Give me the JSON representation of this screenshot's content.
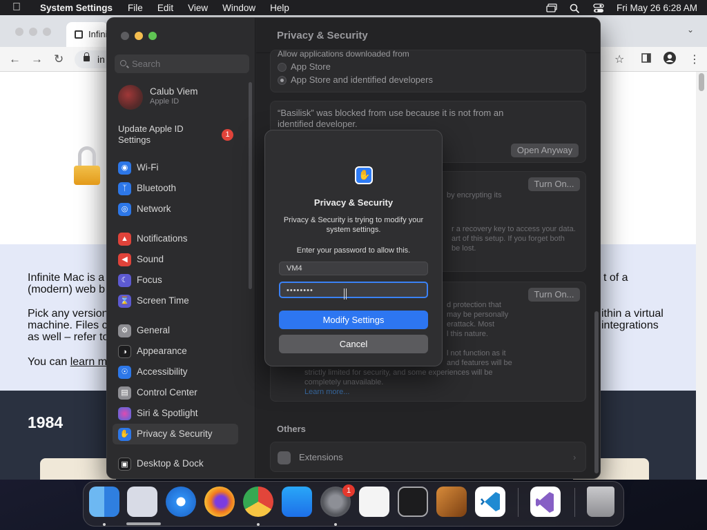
{
  "menubar": {
    "app": "System Settings",
    "items": [
      "File",
      "Edit",
      "View",
      "Window",
      "Help"
    ],
    "clock": "Fri May 26  6:28 AM"
  },
  "browser": {
    "tab_title": "Infini",
    "url": "in",
    "page_text": {
      "p1_line1": "Infinite Mac is a",
      "p1_line2": "(modern) web b",
      "p1_right": "t of a",
      "p2_line1": "Pick any version",
      "p2_line2": "machine. Files c",
      "p2_line3": "as well – refer to",
      "p2_right1": "ithin a virtual",
      "p2_right2": "integrations",
      "p3_prefix": "You can ",
      "p3_link": "learn m",
      "year": "1984"
    }
  },
  "settings": {
    "search_placeholder": "Search",
    "user": {
      "name": "Calub Viem",
      "subtitle": "Apple ID"
    },
    "update": {
      "line1": "Update Apple ID",
      "line2": "Settings",
      "badge": "1"
    },
    "sidebar": [
      {
        "label": "Wi-Fi",
        "icon": "wifi-icon",
        "color": "#2d77e8"
      },
      {
        "label": "Bluetooth",
        "icon": "bluetooth-icon",
        "color": "#2d77e8"
      },
      {
        "label": "Network",
        "icon": "globe-icon",
        "color": "#2d77e8"
      },
      {
        "label": "Notifications",
        "icon": "bell-icon",
        "color": "#e0433a"
      },
      {
        "label": "Sound",
        "icon": "speaker-icon",
        "color": "#e0433a"
      },
      {
        "label": "Focus",
        "icon": "moon-icon",
        "color": "#5d5ad1"
      },
      {
        "label": "Screen Time",
        "icon": "hourglass-icon",
        "color": "#5d5ad1"
      },
      {
        "label": "General",
        "icon": "gear-icon",
        "color": "#8e8e93"
      },
      {
        "label": "Appearance",
        "icon": "circle-half-icon",
        "color": "#1c1c1e"
      },
      {
        "label": "Accessibility",
        "icon": "accessibility-icon",
        "color": "#2d77e8"
      },
      {
        "label": "Control Center",
        "icon": "control-center-icon",
        "color": "#8e8e93"
      },
      {
        "label": "Siri & Spotlight",
        "icon": "siri-icon",
        "color": "#9b3bd6"
      },
      {
        "label": "Privacy & Security",
        "icon": "hand-icon",
        "color": "#2d77e8"
      },
      {
        "label": "Desktop & Dock",
        "icon": "dock-icon",
        "color": "#1c1c1e"
      }
    ],
    "content": {
      "title": "Privacy & Security",
      "allow_label": "Allow applications downloaded from",
      "opt_app_store": "App Store",
      "opt_app_store_devs": "App Store and identified developers",
      "blocked_line1": "“Basilisk” was blocked from use because it is not from an",
      "blocked_line2": "identified developer.",
      "open_anyway": "Open Anyway",
      "turn_on_1": "Turn On...",
      "fv_text": "by encrypting its",
      "rk_line1": "r a recovery key to access your data.",
      "rk_line2": "art of this setup. If you forget both",
      "rk_line3": "be lost.",
      "turn_on_2": "Turn On...",
      "ld_line1": "d protection that",
      "ld_line2": "may be personally",
      "ld_line3": "erattack. Most",
      "ld_line4": "l this nature.",
      "ld_line5": "l not function as it",
      "ld_line6": "and features will be",
      "ld_line7": "strictly limited for security, and some experiences will be",
      "ld_line8": "completely unavailable.",
      "learn_more": "Learn more...",
      "others": "Others",
      "extensions": "Extensions"
    }
  },
  "dialog": {
    "title": "Privacy & Security",
    "message": "Privacy & Security is trying to modify your system settings.",
    "prompt": "Enter your password to allow this.",
    "username": "VM4",
    "password": "••••••••",
    "primary": "Modify Settings",
    "secondary": "Cancel"
  },
  "dock": {
    "badge": "1",
    "apps": [
      "finder-icon",
      "launchpad-icon",
      "safari-icon",
      "firefox-icon",
      "chrome-icon",
      "app-store-icon",
      "system-settings-icon",
      "textedit-icon",
      "terminal-icon",
      "garageband-icon",
      "vscode-icon",
      "visual-studio-icon",
      "trash-icon"
    ]
  }
}
